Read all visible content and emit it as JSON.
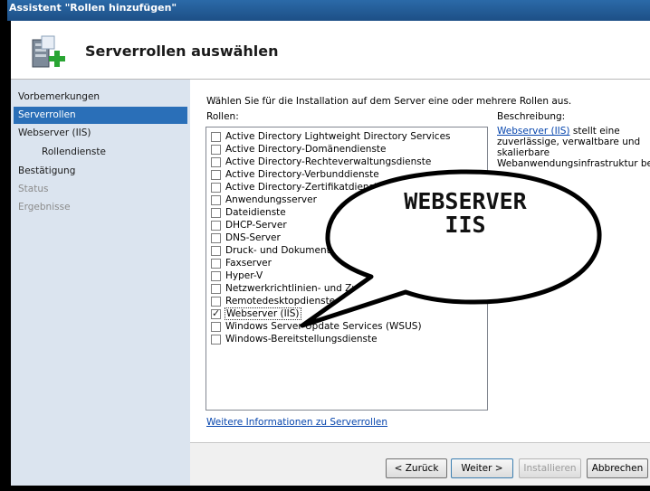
{
  "window": {
    "title": "Assistent \"Rollen hinzufügen\""
  },
  "header": {
    "title": "Serverrollen auswählen",
    "icon": "server-add-icon"
  },
  "nav": {
    "items": [
      {
        "label": "Vorbemerkungen",
        "state": "normal"
      },
      {
        "label": "Serverrollen",
        "state": "active"
      },
      {
        "label": "Webserver (IIS)",
        "state": "normal"
      },
      {
        "label": "Rollendienste",
        "state": "sub"
      },
      {
        "label": "Bestätigung",
        "state": "normal"
      },
      {
        "label": "Status",
        "state": "disabled"
      },
      {
        "label": "Ergebnisse",
        "state": "disabled"
      }
    ]
  },
  "main": {
    "instruction": "Wählen Sie für die Installation auf dem Server eine oder mehrere Rollen aus.",
    "roles_label": "Rollen:",
    "description_label": "Beschreibung:",
    "description_link": "Webserver (IIS)",
    "description_text": " stellt eine zuverlässige, verwaltbare und skalierbare Webanwendungsinfrastruktur bereit.",
    "roles": [
      {
        "label": "Active Directory Lightweight Directory Services",
        "checked": false
      },
      {
        "label": "Active Directory-Domänendienste",
        "checked": false
      },
      {
        "label": "Active Directory-Rechteverwaltungsdienste",
        "checked": false
      },
      {
        "label": "Active Directory-Verbunddienste",
        "checked": false
      },
      {
        "label": "Active Directory-Zertifikatdienste",
        "checked": false
      },
      {
        "label": "Anwendungsserver",
        "checked": false
      },
      {
        "label": "Dateidienste",
        "checked": false
      },
      {
        "label": "DHCP-Server",
        "checked": false
      },
      {
        "label": "DNS-Server",
        "checked": false
      },
      {
        "label": "Druck- und Dokumentdienste",
        "checked": false
      },
      {
        "label": "Faxserver",
        "checked": false
      },
      {
        "label": "Hyper-V",
        "checked": false
      },
      {
        "label": "Netzwerkrichtlinien- und Zugriffsdienste",
        "checked": false
      },
      {
        "label": "Remotedesktopdienste",
        "checked": false
      },
      {
        "label": "Webserver (IIS)",
        "checked": true,
        "selected": true
      },
      {
        "label": "Windows Server Update Services (WSUS)",
        "checked": false
      },
      {
        "label": "Windows-Bereitstellungsdienste",
        "checked": false
      }
    ],
    "more_info_link": "Weitere Informationen zu Serverrollen"
  },
  "buttons": {
    "back": "< Zurück",
    "next": "Weiter >",
    "install": "Installieren",
    "cancel": "Abbrechen"
  },
  "callout": {
    "line1": "WEBSERVER",
    "line2": "IIS"
  },
  "colors": {
    "nav_bg": "#dbe4ef",
    "nav_active": "#2a6fb8",
    "link": "#0645ad",
    "titlebar": "#2b6aa8"
  }
}
